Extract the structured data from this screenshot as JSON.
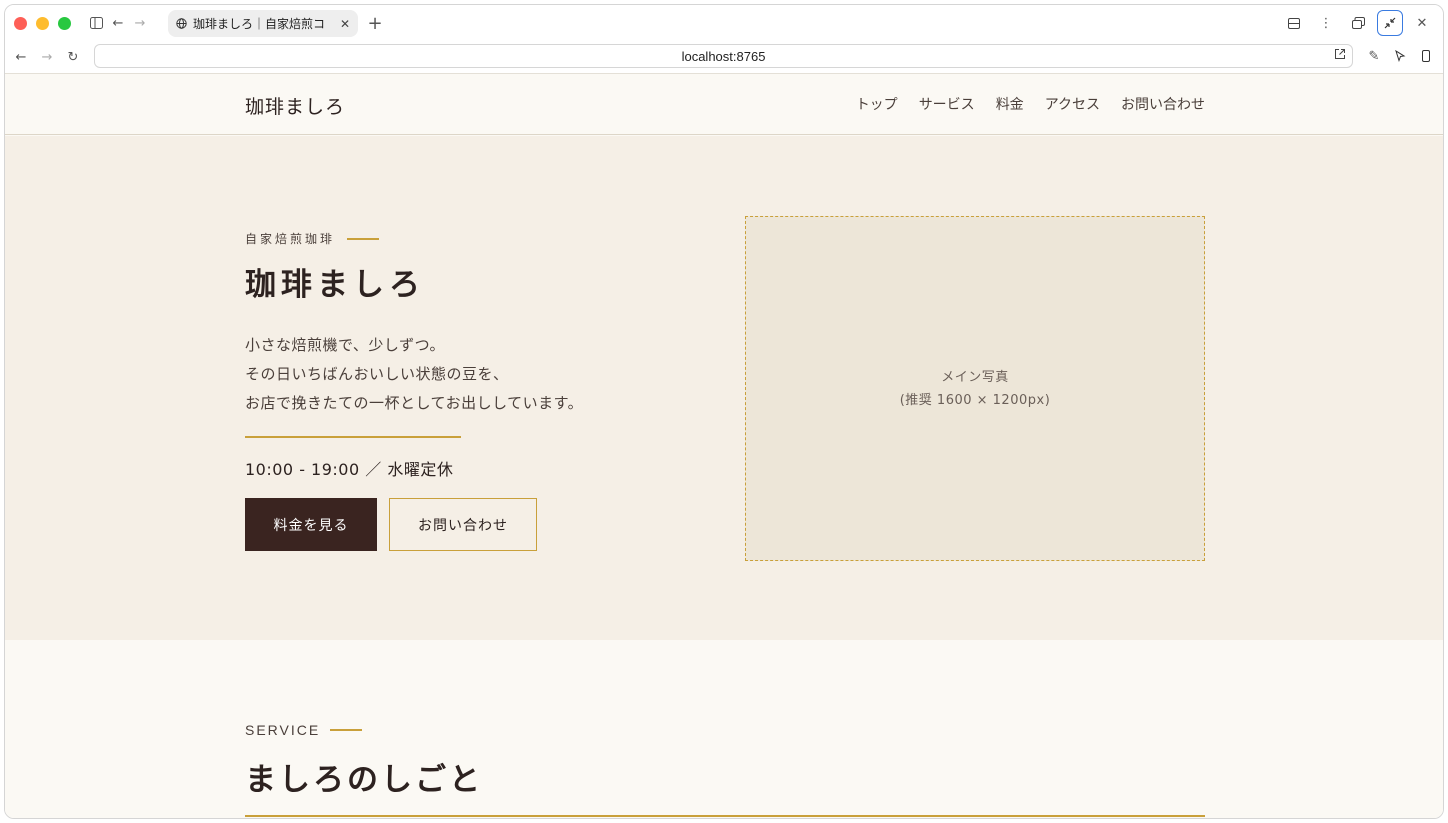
{
  "browser": {
    "tab_title": "珈琲ましろ｜自家焙煎コ",
    "url": "localhost:8765"
  },
  "header": {
    "logo": "珈琲ましろ",
    "nav": [
      "トップ",
      "サービス",
      "料金",
      "アクセス",
      "お問い合わせ"
    ]
  },
  "hero": {
    "eyebrow": "自家焙煎珈琲",
    "title": "珈琲ましろ",
    "lead": [
      "小さな焙煎機で、少しずつ。",
      "その日いちばんおいしい状態の豆を、",
      "お店で挽きたての一杯としてお出ししています。"
    ],
    "hours": "10:00 - 19:00 ／ 水曜定休",
    "primary_button": "料金を見る",
    "secondary_button": "お問い合わせ",
    "photo_label": "メイン写真",
    "photo_note": "(推奨 1600 × 1200px)"
  },
  "service": {
    "eyebrow": "SERVICE",
    "title": "ましろのしごと"
  },
  "colors": {
    "accent_gold": "#c9a03a",
    "dark_brown": "#3a2420",
    "hero_bg": "#f5efe6",
    "page_bg": "#fbf9f4"
  }
}
